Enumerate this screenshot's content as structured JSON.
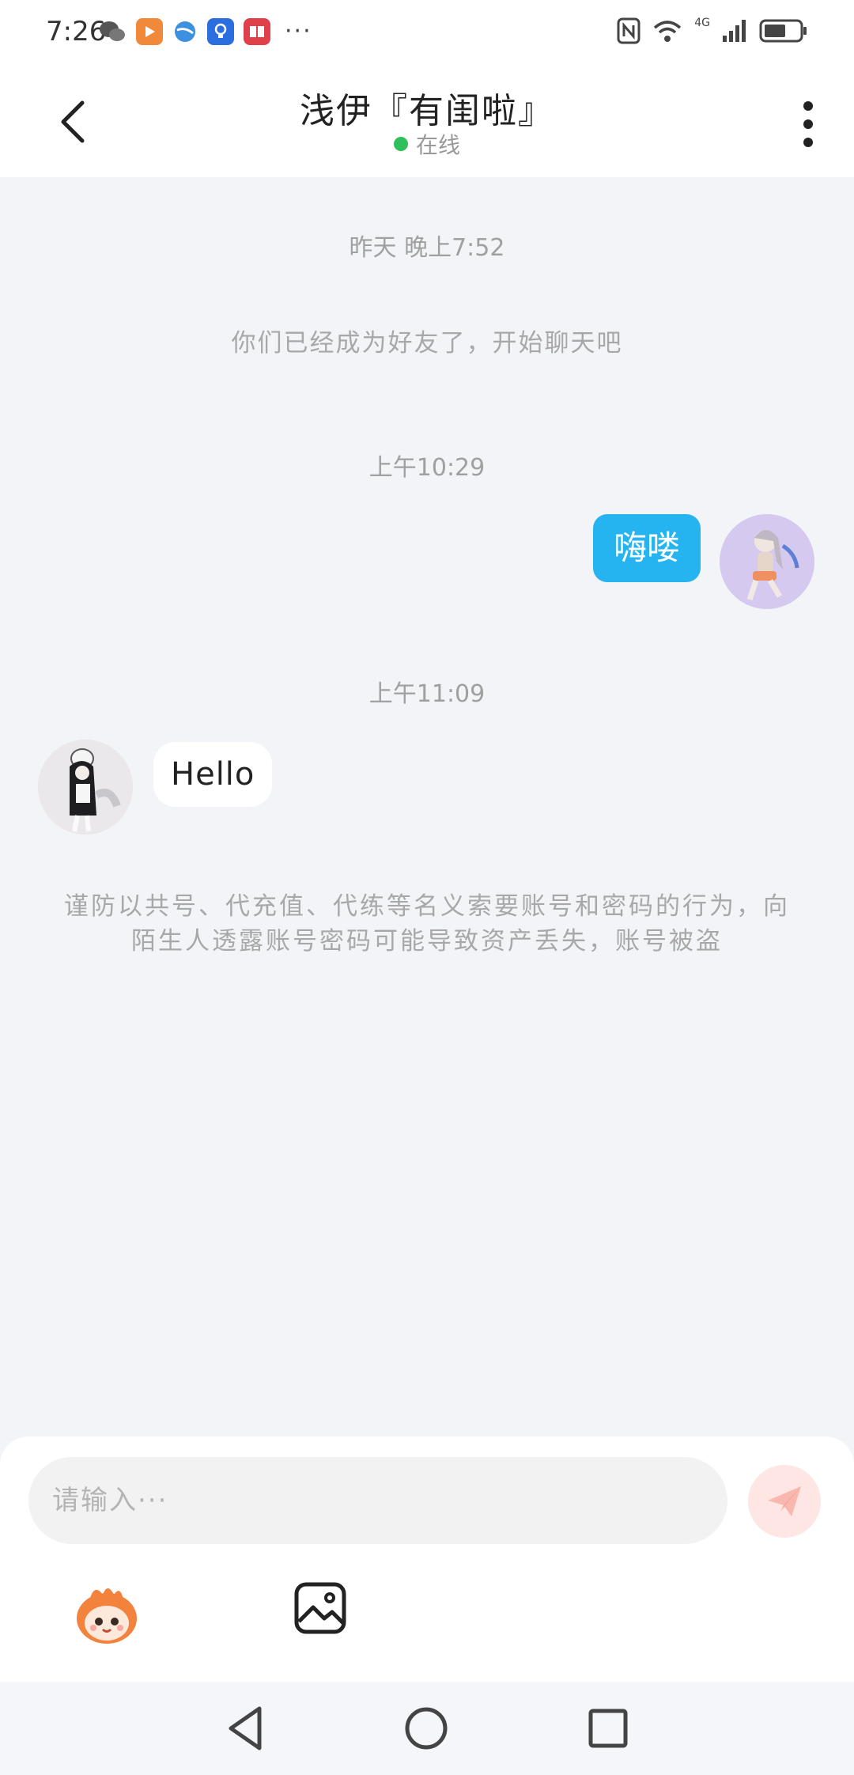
{
  "status_bar": {
    "time": "7:26",
    "network": "4G",
    "app_icons": [
      "wechat-icon",
      "video-icon",
      "browser-icon",
      "bulb-icon",
      "book-icon"
    ],
    "more": "···"
  },
  "header": {
    "title": "浅伊『有闺啦』",
    "status": "在线",
    "status_color": "#2ec05a"
  },
  "chat": {
    "time_1": "昨天 晚上7:52",
    "system_friend": "你们已经成为好友了，开始聊天吧",
    "time_2": "上午10:29",
    "outgoing_message": "嗨喽",
    "time_3": "上午11:09",
    "incoming_message": "Hello",
    "warning": "谨防以共号、代充值、代练等名义索要账号和密码的行为，向陌生人透露账号密码可能导致资产丢失，账号被盗"
  },
  "input": {
    "placeholder": "请输入···",
    "value": ""
  },
  "colors": {
    "accent_blue": "#25b4f0",
    "send_button_bg": "#fde6e3",
    "chat_bg": "#f2f4f7"
  },
  "icons": {
    "back": "back-arrow-icon",
    "more": "more-vertical-icon",
    "send": "send-icon",
    "emoji": "emoji-icon",
    "image": "image-icon"
  }
}
